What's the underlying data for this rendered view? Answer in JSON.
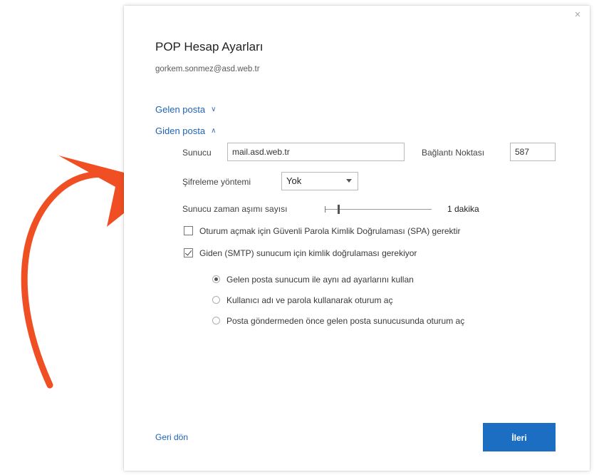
{
  "dialog": {
    "title": "POP Hesap Ayarları",
    "email": "gorkem.sonmez@asd.web.tr",
    "close_glyph": "×"
  },
  "sections": {
    "incoming": {
      "label": "Gelen posta",
      "chevron": "∨"
    },
    "outgoing": {
      "label": "Giden posta",
      "chevron": "∧"
    }
  },
  "outgoing": {
    "server_label": "Sunucu",
    "server_value": "mail.asd.web.tr",
    "port_label": "Bağlantı Noktası",
    "port_value": "587",
    "encryption_label": "Şifreleme yöntemi",
    "encryption_value": "Yok",
    "timeout_label": "Sunucu zaman aşımı sayısı",
    "timeout_value": "1 dakika",
    "timeout_fraction": 0.12,
    "spa_label": "Oturum açmak için Güvenli Parola Kimlik Doğrulaması (SPA) gerektir",
    "spa_checked": false,
    "smtp_auth_label": "Giden (SMTP) sunucum için kimlik doğrulaması gerekiyor",
    "smtp_auth_checked": true,
    "auth_options": [
      {
        "label": "Gelen posta sunucum ile aynı ad ayarlarını kullan",
        "selected": true
      },
      {
        "label": "Kullanıcı adı ve parola kullanarak oturum aç",
        "selected": false
      },
      {
        "label": "Posta göndermeden önce gelen posta sunucusunda oturum aç",
        "selected": false
      }
    ]
  },
  "footer": {
    "back_label": "Geri dön",
    "next_label": "İleri"
  },
  "colors": {
    "accent": "#1b6ec2",
    "link": "#1f63b5",
    "arrow": "#f04e23"
  }
}
